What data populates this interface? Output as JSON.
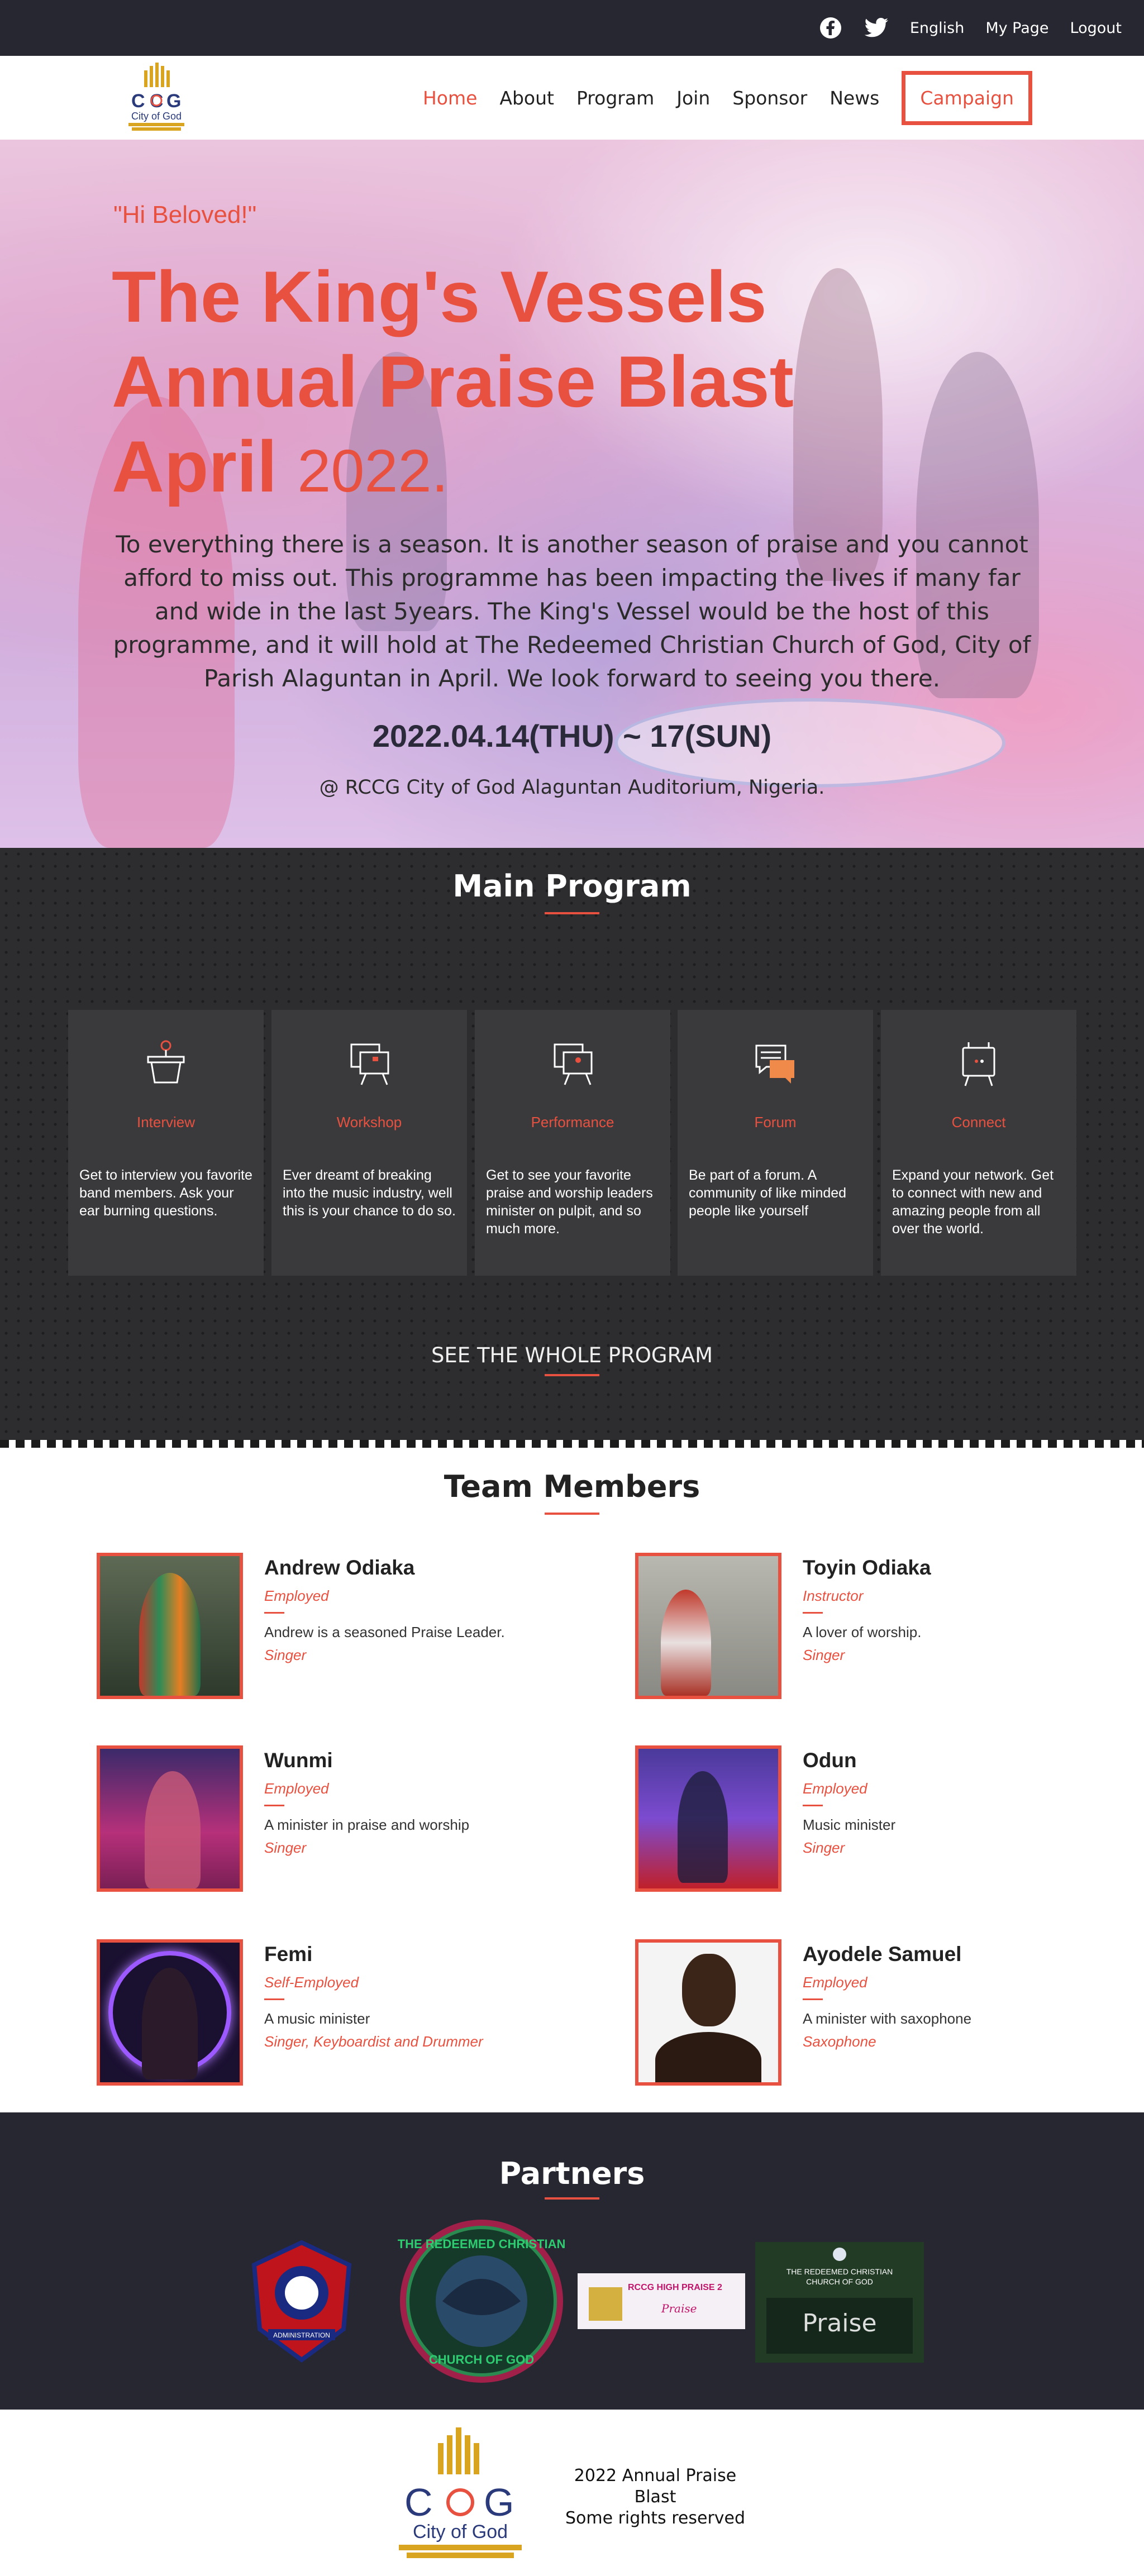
{
  "topbar": {
    "icons": [
      "facebook-icon",
      "twitter-icon"
    ],
    "links": [
      "English",
      "My Page",
      "Logout"
    ]
  },
  "nav": {
    "logo_text": "COG",
    "logo_sub": "City of God",
    "items": [
      "Home",
      "About",
      "Program",
      "Join",
      "Sponsor",
      "News"
    ],
    "campaign": "Campaign",
    "active": "Home"
  },
  "hero": {
    "greeting": "\"Hi Beloved!\"",
    "title_line1": "The King's Vessels",
    "title_line2": "Annual Praise Blast",
    "title_line3a": "April",
    "title_line3b": "2022.",
    "description": "To everything there is a season. It is another season of praise and you cannot afford to miss out. This programme has been impacting the lives if many far and wide in the last 5years. The King's Vessel would be the host of this programme, and it will hold at The Redeemed Christian Church of God, City of Parish Alaguntan in April. We look forward to seeing you there.",
    "dates": "2022.04.14(THU) ~ 17(SUN)",
    "venue": "@ RCCG City of God Alaguntan Auditorium, Nigeria."
  },
  "program": {
    "title": "Main Program",
    "cards": [
      {
        "name": "Interview",
        "icon": "basket-icon",
        "desc": "Get to interview you favorite band members. Ask your ear burning questions."
      },
      {
        "name": "Workshop",
        "icon": "easel-icon",
        "desc": "Ever dreamt of breaking into the music industry, well this is your chance to do so."
      },
      {
        "name": "Performance",
        "icon": "presentation-icon",
        "desc": "Get to see your favorite praise and worship leaders minister on pulpit, and so much more."
      },
      {
        "name": "Forum",
        "icon": "chat-bubbles-icon",
        "desc": "Be part of a forum. A community of like minded people like yourself"
      },
      {
        "name": "Connect",
        "icon": "board-icon",
        "desc": "Expand your network. Get to connect with new and amazing people from all over the world."
      }
    ],
    "see_all": "SEE THE WHOLE PROGRAM"
  },
  "team": {
    "title": "Team Members",
    "members": [
      {
        "name": "Andrew Odiaka",
        "role": "Employed",
        "desc": "Andrew is a seasoned Praise Leader.",
        "skill": "Singer"
      },
      {
        "name": "Toyin Odiaka",
        "role": "Instructor",
        "desc": "A lover of worship.",
        "skill": "Singer"
      },
      {
        "name": "Wunmi",
        "role": "Employed",
        "desc": "A minister in praise and worship",
        "skill": "Singer"
      },
      {
        "name": "Odun",
        "role": "Employed",
        "desc": "Music minister",
        "skill": "Singer"
      },
      {
        "name": "Femi",
        "role": "Self-Employed",
        "desc": "A music minister",
        "skill": "Singer, Keyboardist and Drummer"
      },
      {
        "name": "Ayodele Samuel",
        "role": "Employed",
        "desc": "A minister with saxophone",
        "skill": "Saxophone"
      }
    ]
  },
  "partners": {
    "title": "Partners",
    "logos": [
      {
        "name": "rccg-admin-logo",
        "text": "ADMINISTRATION"
      },
      {
        "name": "rccg-city-of-god-logo",
        "text": "THE REDEEMED CHRISTIAN CHURCH OF GOD"
      },
      {
        "name": "praise-banner-logo",
        "text": "RCCG HIGH PRAISE 2"
      },
      {
        "name": "praise-team-logo",
        "text": "THE REDEEMED CHRISTIAN CHURCH OF GOD"
      }
    ]
  },
  "footer": {
    "line1": "2022 Annual Praise Blast",
    "line2": "Some rights reserved"
  },
  "colors": {
    "accent": "#e8513f",
    "dark": "#262730",
    "program_bg": "#2d2d2f",
    "card_bg": "#3a3a3d"
  }
}
